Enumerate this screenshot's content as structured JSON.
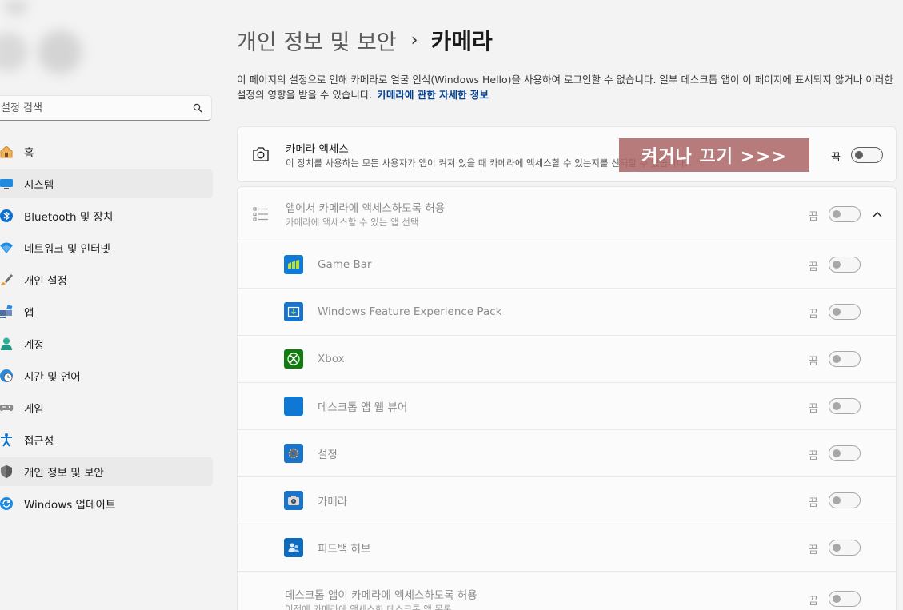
{
  "sidebar": {
    "search_placeholder": "설정 검색",
    "items": [
      {
        "label": "홈",
        "icon": "home-icon"
      },
      {
        "label": "시스템",
        "icon": "system-icon",
        "active": true
      },
      {
        "label": "Bluetooth 및 장치",
        "icon": "bluetooth-icon"
      },
      {
        "label": "네트워크 및 인터넷",
        "icon": "wifi-icon"
      },
      {
        "label": "개인 설정",
        "icon": "brush-icon"
      },
      {
        "label": "앱",
        "icon": "apps-icon"
      },
      {
        "label": "계정",
        "icon": "account-icon"
      },
      {
        "label": "시간 및 언어",
        "icon": "globe-clock-icon"
      },
      {
        "label": "게임",
        "icon": "gamepad-icon"
      },
      {
        "label": "접근성",
        "icon": "accessibility-icon"
      },
      {
        "label": "개인 정보 및 보안",
        "icon": "shield-icon",
        "active": true
      },
      {
        "label": "Windows 업데이트",
        "icon": "update-icon"
      }
    ]
  },
  "breadcrumb": {
    "parent": "개인 정보 및 보안",
    "separator": "›",
    "current": "카메라"
  },
  "description": {
    "text": "이 페이지의 설정으로 인해 카메라로 얼굴 인식(Windows Hello)을 사용하여 로그인할 수 없습니다. 일부 데스크톱 앱이 이 페이지에 표시되지 않거나 이러한 설정의 영향을 받을 수 있습니다.",
    "link": "카메라에 관한 자세한 정보"
  },
  "camera_access": {
    "title": "카메라 액세스",
    "subtitle": "이 장치를 사용하는 모든 사용자가 앱이 켜져 있을 때 카메라에 액세스할 수 있는지를 선택할 수 있습니다.",
    "state": "끔"
  },
  "overlay": {
    "text": "켜거나 끄기 >>>"
  },
  "app_access": {
    "title": "앱에서 카메라에 액세스하도록 허용",
    "subtitle": "카메라에 액세스할 수 있는 앱 선택",
    "state": "끔"
  },
  "apps": [
    {
      "name": "Game Bar",
      "state": "끔",
      "icon": "game-bar-icon",
      "color": "#0f7bd6"
    },
    {
      "name": "Windows Feature Experience Pack",
      "state": "끔",
      "icon": "feature-pack-icon",
      "color": "#1a73c7"
    },
    {
      "name": "Xbox",
      "state": "끔",
      "icon": "xbox-icon",
      "color": "#107c10"
    },
    {
      "name": "데스크톱 앱 웹 뷰어",
      "state": "끔",
      "icon": "web-viewer-icon",
      "color": "#0f78d4"
    },
    {
      "name": "설정",
      "state": "끔",
      "icon": "settings-gear-icon",
      "color": "#1b74c8"
    },
    {
      "name": "카메라",
      "state": "끔",
      "icon": "camera-app-icon",
      "color": "#1b74c8"
    },
    {
      "name": "피드백 허브",
      "state": "끔",
      "icon": "feedback-hub-icon",
      "color": "#0f6cbd"
    }
  ],
  "desktop_access": {
    "title": "데스크톱 앱이 카메라에 액세스하도록 허용",
    "subtitle": "이전에 카메라에 액세스한 데스크톱 앱 목록",
    "state": "끔"
  }
}
